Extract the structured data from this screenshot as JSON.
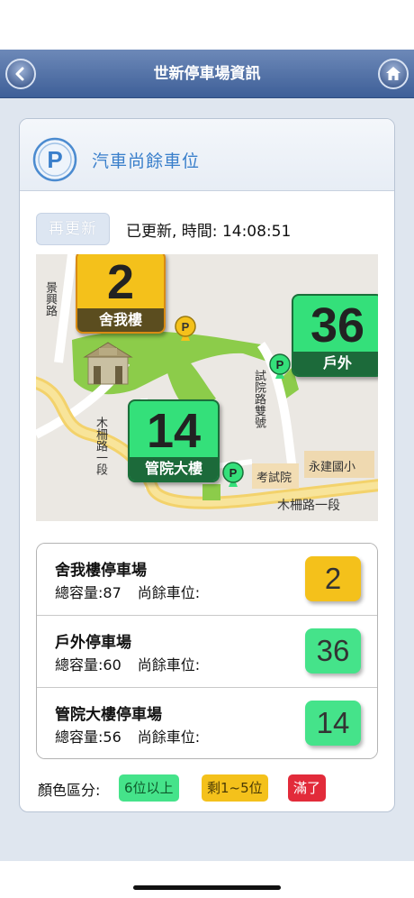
{
  "nav": {
    "title": "世新停車場資訊",
    "back_icon": "chevron-left-icon",
    "home_icon": "home-icon"
  },
  "card": {
    "title": "汽車尚餘車位",
    "icon": "parking-icon"
  },
  "refresh": {
    "button_label": "再更新",
    "status_text": "已更新, 時間:  14:08:51"
  },
  "map": {
    "badges": {
      "shewo": {
        "count": "2",
        "label": "舍我樓",
        "color": "#f4c11b"
      },
      "outdoor": {
        "count": "36",
        "label": "戶外",
        "color": "#34e07a"
      },
      "guanyuan": {
        "count": "14",
        "label": "管院大樓",
        "color": "#34e07a"
      }
    },
    "streets": {
      "jingxing": "景興路",
      "muzha_vertical": "木柵路一段",
      "shiyuan": "試院路雙號",
      "muzha_horizontal": "木柵路一段",
      "kaoshiyuan": "考試院",
      "yongjian": "永建國小"
    }
  },
  "lots": [
    {
      "name": "舍我樓停車場",
      "capacity": "總容量:87",
      "remaining_label": "尚餘車位:",
      "count": "2",
      "color": "#f4c11b"
    },
    {
      "name": "戶外停車場",
      "capacity": "總容量:60",
      "remaining_label": "尚餘車位:",
      "count": "36",
      "color": "#45e38a"
    },
    {
      "name": "管院大樓停車場",
      "capacity": "總容量:56",
      "remaining_label": "尚餘車位:",
      "count": "14",
      "color": "#45e38a"
    }
  ],
  "legend": {
    "label": "顏色區分:",
    "green": "6位以上",
    "yellow": "剩1~5位",
    "red": "滿了"
  }
}
